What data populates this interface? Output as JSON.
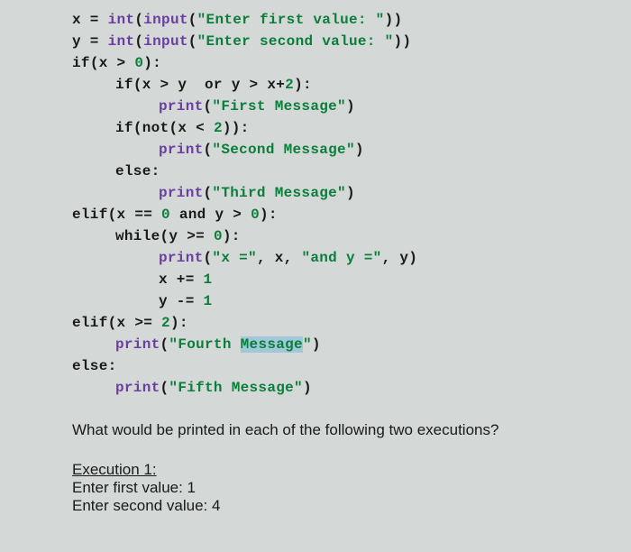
{
  "code": {
    "l1_a": "x = ",
    "l1_b": "int",
    "l1_c": "(",
    "l1_d": "input",
    "l1_e": "(",
    "l1_f": "\"Enter first value: \"",
    "l1_g": "))",
    "l2_a": "y = ",
    "l2_b": "int",
    "l2_c": "(",
    "l2_d": "input",
    "l2_e": "(",
    "l2_f": "\"Enter second value: \"",
    "l2_g": "))",
    "l3_a": "if",
    "l3_b": "(x > ",
    "l3_c": "0",
    "l3_d": "):",
    "l4_a": "if",
    "l4_b": "(x > y  ",
    "l4_c": "or",
    "l4_d": " y > x+",
    "l4_e": "2",
    "l4_f": "):",
    "l5_a": "print",
    "l5_b": "(",
    "l5_c": "\"First Message\"",
    "l5_d": ")",
    "l6_a": "if",
    "l6_b": "(",
    "l6_c": "not",
    "l6_d": "(x < ",
    "l6_e": "2",
    "l6_f": ")):",
    "l7_a": "print",
    "l7_b": "(",
    "l7_c": "\"Second Message\"",
    "l7_d": ")",
    "l8_a": "else",
    "l8_b": ":",
    "l9_a": "print",
    "l9_b": "(",
    "l9_c": "\"Third Message\"",
    "l9_d": ")",
    "l10_a": "elif",
    "l10_b": "(x == ",
    "l10_c": "0",
    "l10_d": " ",
    "l10_e": "and",
    "l10_f": " y > ",
    "l10_g": "0",
    "l10_h": "):",
    "l11_a": "while",
    "l11_b": "(y >= ",
    "l11_c": "0",
    "l11_d": "):",
    "l12_a": "print",
    "l12_b": "(",
    "l12_c": "\"x =\"",
    "l12_d": ", x, ",
    "l12_e": "\"and y =\"",
    "l12_f": ", y)",
    "l13_a": "x += ",
    "l13_b": "1",
    "l14_a": "y -= ",
    "l14_b": "1",
    "l15_a": "elif",
    "l15_b": "(x >= ",
    "l15_c": "2",
    "l15_d": "):",
    "l16_a": "print",
    "l16_b": "(",
    "l16_c": "\"Fourth ",
    "l16_d": "Message",
    "l16_e": "\"",
    "l16_f": ")",
    "l17_a": "else",
    "l17_b": ":",
    "l18_a": "print",
    "l18_b": "(",
    "l18_c": "\"Fifth Message\"",
    "l18_d": ")"
  },
  "question": {
    "prompt": "What would be printed in each of the following two executions?",
    "exec_label": "Execution 1:",
    "line1": "Enter first value:  1",
    "line2": "Enter second value:  4"
  }
}
